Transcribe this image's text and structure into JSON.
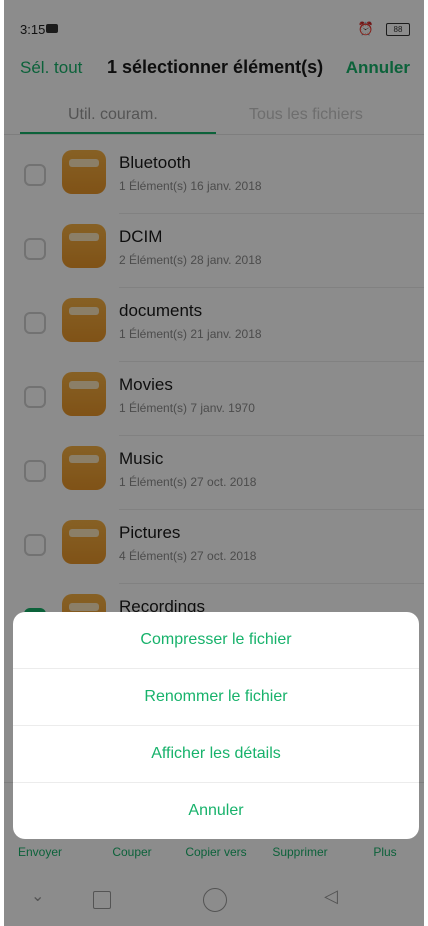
{
  "status_bar": {
    "time": "3:15",
    "battery": "88"
  },
  "top_bar": {
    "select_all": "Sél. tout",
    "title": "1 sélectionner élément(s)",
    "cancel": "Annuler"
  },
  "tabs": [
    {
      "label": "Util. couram.",
      "selected": true
    },
    {
      "label": "Tous les fichiers",
      "selected": false
    }
  ],
  "files": [
    {
      "name": "Bluetooth",
      "count": "1 Élément(s)",
      "date": "16 janv. 2018",
      "checked": false
    },
    {
      "name": "DCIM",
      "count": "2 Élément(s)",
      "date": "28 janv. 2018",
      "checked": false
    },
    {
      "name": "documents",
      "count": "1 Élément(s)",
      "date": "21 janv. 2018",
      "checked": false
    },
    {
      "name": "Movies",
      "count": "1 Élément(s)",
      "date": "7 janv. 1970",
      "checked": false
    },
    {
      "name": "Music",
      "count": "1 Élément(s)",
      "date": "27 oct. 2018",
      "checked": false
    },
    {
      "name": "Pictures",
      "count": "4 Élément(s)",
      "date": "27 oct. 2018",
      "checked": false
    },
    {
      "name": "Recordings",
      "count": "",
      "date": "",
      "checked": true
    }
  ],
  "toolbar": {
    "send": "Envoyer",
    "cut": "Couper",
    "copy_to": "Copier vers",
    "delete": "Supprimer",
    "more": "Plus"
  },
  "action_sheet": {
    "compress": "Compresser le fichier",
    "rename": "Renommer le fichier",
    "details": "Afficher les détails",
    "cancel": "Annuler"
  },
  "colors": {
    "accent": "#17b26b",
    "folder": "#eea235"
  }
}
